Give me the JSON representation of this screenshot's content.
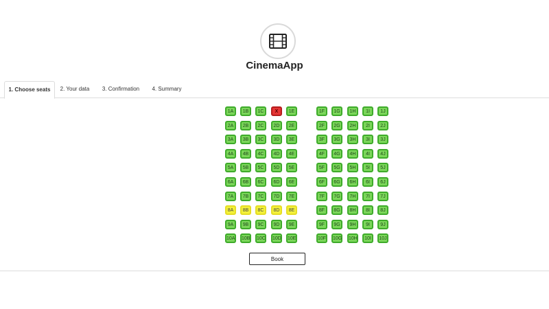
{
  "app": {
    "title": "CinemaApp",
    "logo_icon": "film-icon"
  },
  "tabs": [
    {
      "label": "1. Choose seats",
      "active": true
    },
    {
      "label": "2. Your data",
      "active": false
    },
    {
      "label": "3. Confirmation",
      "active": false
    },
    {
      "label": "4. Summary",
      "active": false
    }
  ],
  "seating": {
    "rows": [
      "1",
      "2",
      "3",
      "4",
      "5",
      "6",
      "7",
      "8",
      "9",
      "10"
    ],
    "left_columns": [
      "A",
      "B",
      "C",
      "D",
      "E"
    ],
    "right_columns": [
      "F",
      "G",
      "H",
      "I",
      "J"
    ],
    "taken": [
      "1D"
    ],
    "taken_label": "X",
    "selected": [
      "8A",
      "8B",
      "8C",
      "8D",
      "8E"
    ],
    "status_colors": {
      "available": "#7bd65a",
      "selected": "#f4f23a",
      "taken": "#e53535"
    }
  },
  "actions": {
    "book_label": "Book"
  }
}
